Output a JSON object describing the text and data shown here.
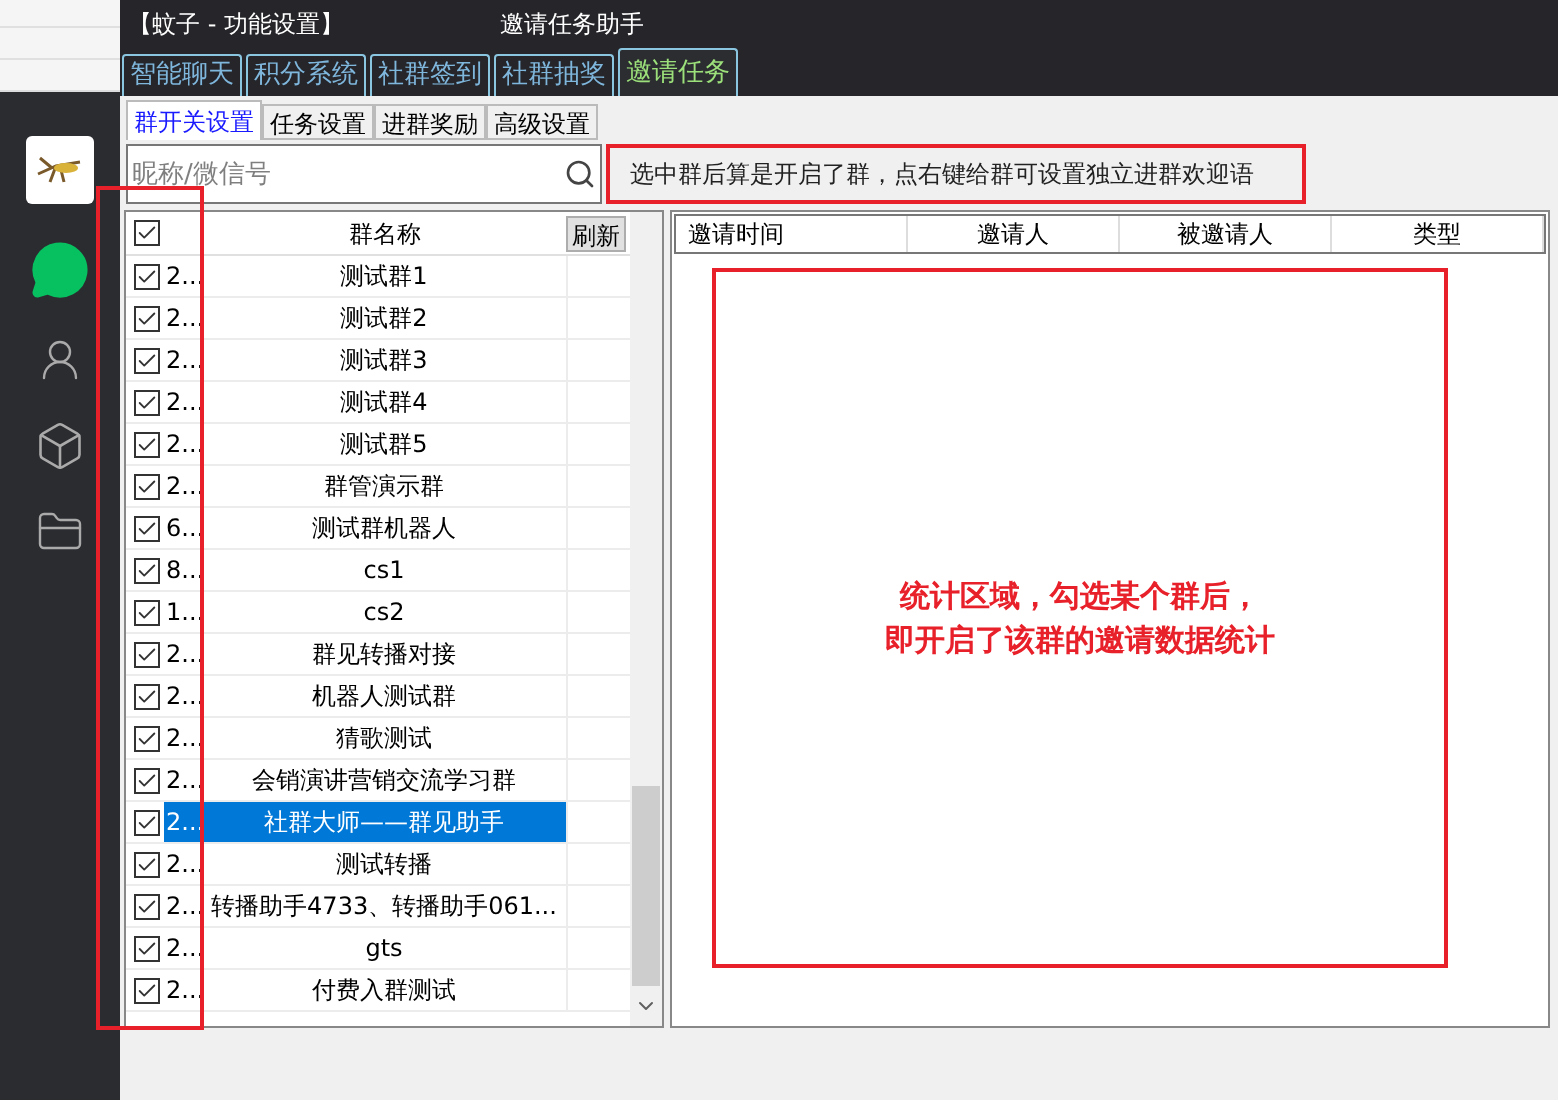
{
  "window": {
    "title": "【蚊子 - 功能设置】",
    "subtitle": "邀请任务助手"
  },
  "main_tabs": [
    {
      "label": "智能聊天",
      "selected": false
    },
    {
      "label": "积分系统",
      "selected": false
    },
    {
      "label": "社群签到",
      "selected": false
    },
    {
      "label": "社群抽奖",
      "selected": false
    },
    {
      "label": "邀请任务",
      "selected": true
    }
  ],
  "sub_tabs": [
    {
      "label": "群开关设置",
      "selected": true
    },
    {
      "label": "任务设置",
      "selected": false
    },
    {
      "label": "进群奖励",
      "selected": false
    },
    {
      "label": "高级设置",
      "selected": false
    }
  ],
  "search": {
    "placeholder": "昵称/微信号"
  },
  "note": "选中群后算是开启了群，点右键给群可设置独立进群欢迎语",
  "group_list": {
    "header_checked": true,
    "column": "群名称",
    "refresh_button": "刷新",
    "rows": [
      {
        "id": "2...",
        "name": "测试群1",
        "checked": true,
        "selected": false
      },
      {
        "id": "2...",
        "name": "测试群2",
        "checked": true,
        "selected": false
      },
      {
        "id": "2...",
        "name": "测试群3",
        "checked": true,
        "selected": false
      },
      {
        "id": "2...",
        "name": "测试群4",
        "checked": true,
        "selected": false
      },
      {
        "id": "2...",
        "name": "测试群5",
        "checked": true,
        "selected": false
      },
      {
        "id": "2...",
        "name": "群管演示群",
        "checked": true,
        "selected": false
      },
      {
        "id": "6...",
        "name": "测试群机器人",
        "checked": true,
        "selected": false
      },
      {
        "id": "8...",
        "name": "cs1",
        "checked": true,
        "selected": false
      },
      {
        "id": "1...",
        "name": "cs2",
        "checked": true,
        "selected": false
      },
      {
        "id": "2...",
        "name": "群见转播对接",
        "checked": true,
        "selected": false
      },
      {
        "id": "2...",
        "name": "机器人测试群",
        "checked": true,
        "selected": false
      },
      {
        "id": "2...",
        "name": "猜歌测试",
        "checked": true,
        "selected": false
      },
      {
        "id": "2...",
        "name": "会销演讲营销交流学习群",
        "checked": true,
        "selected": false
      },
      {
        "id": "2...",
        "name": "社群大师——群见助手",
        "checked": true,
        "selected": true
      },
      {
        "id": "2...",
        "name": "测试转播",
        "checked": true,
        "selected": false
      },
      {
        "id": "2...",
        "name": "转播助手4733、转播助手061...",
        "checked": true,
        "selected": false
      },
      {
        "id": "2...",
        "name": "gts",
        "checked": true,
        "selected": false
      },
      {
        "id": "2...",
        "name": "付费入群测试",
        "checked": true,
        "selected": false
      }
    ]
  },
  "stats_table": {
    "columns": [
      "邀请时间",
      "邀请人",
      "被邀请人",
      "类型"
    ]
  },
  "annotation": {
    "lines": [
      "统计区域，勾选某个群后，",
      "即开启了该群的邀请数据统计"
    ]
  }
}
